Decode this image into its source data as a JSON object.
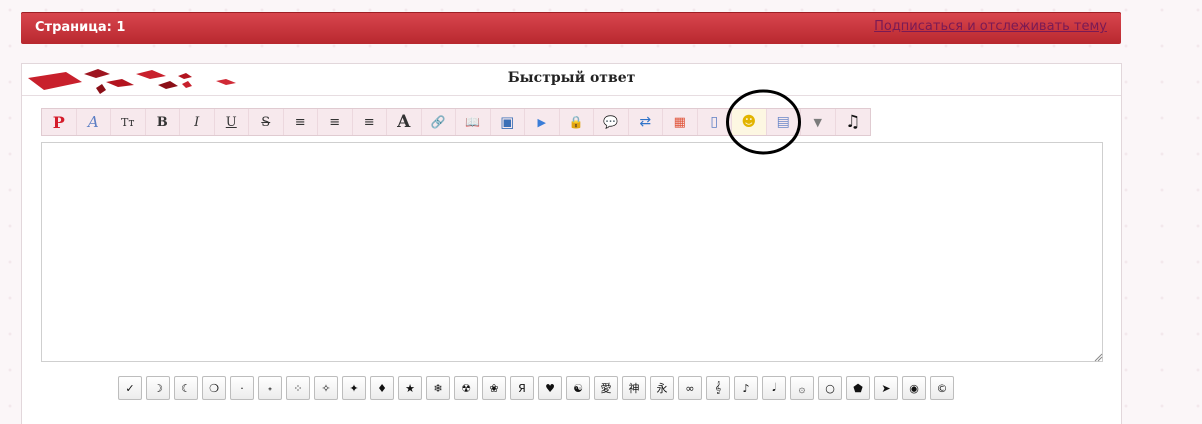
{
  "header": {
    "page_label": "Страница: 1",
    "subscribe_link": "Подписаться и отслеживать тему"
  },
  "quick_reply": {
    "title": "Быстрый ответ"
  },
  "toolbar": [
    {
      "name": "p-logo-button",
      "glyph": "P"
    },
    {
      "name": "font-button",
      "glyph": "A"
    },
    {
      "name": "font-size-button",
      "glyph": "Tт"
    },
    {
      "name": "bold-button",
      "glyph": "B"
    },
    {
      "name": "italic-button",
      "glyph": "I"
    },
    {
      "name": "underline-button",
      "glyph": "U"
    },
    {
      "name": "strikethrough-button",
      "glyph": "S"
    },
    {
      "name": "align-left-button",
      "glyph": "≡"
    },
    {
      "name": "align-center-button",
      "glyph": "≡"
    },
    {
      "name": "align-right-button",
      "glyph": "≡"
    },
    {
      "name": "text-color-button",
      "glyph": "A"
    },
    {
      "name": "link-button",
      "glyph": "🔗"
    },
    {
      "name": "book-button",
      "glyph": "📖"
    },
    {
      "name": "image-button",
      "glyph": "▣"
    },
    {
      "name": "video-button",
      "glyph": "▶"
    },
    {
      "name": "hide-button",
      "glyph": "🔒"
    },
    {
      "name": "quote-button",
      "glyph": "💬"
    },
    {
      "name": "translate-button",
      "glyph": "⇄"
    },
    {
      "name": "colors-button",
      "glyph": "▦"
    },
    {
      "name": "spoiler-button",
      "glyph": "▯"
    },
    {
      "name": "smiley-button",
      "glyph": "☻"
    },
    {
      "name": "symbols-button",
      "glyph": "▤"
    },
    {
      "name": "more-button",
      "glyph": "▼"
    },
    {
      "name": "music-button",
      "glyph": "♫"
    }
  ],
  "symbols": [
    "✓",
    "☽",
    "☾",
    "❍",
    "·",
    "˖",
    "⁘",
    "✧",
    "✦",
    "♦",
    "★",
    "❄",
    "☢",
    "❀",
    "Я",
    "♥",
    "☯",
    "愛",
    "神",
    "永",
    "∞",
    "𝄞",
    "♪",
    "𝅘𝅥",
    "۞",
    "○",
    "⬟",
    "➤",
    "◉",
    "©"
  ],
  "colors": {
    "header_red": "#c9343b",
    "link_purple": "#7a1a55",
    "toolbar_bg": "#f7e9ed"
  }
}
